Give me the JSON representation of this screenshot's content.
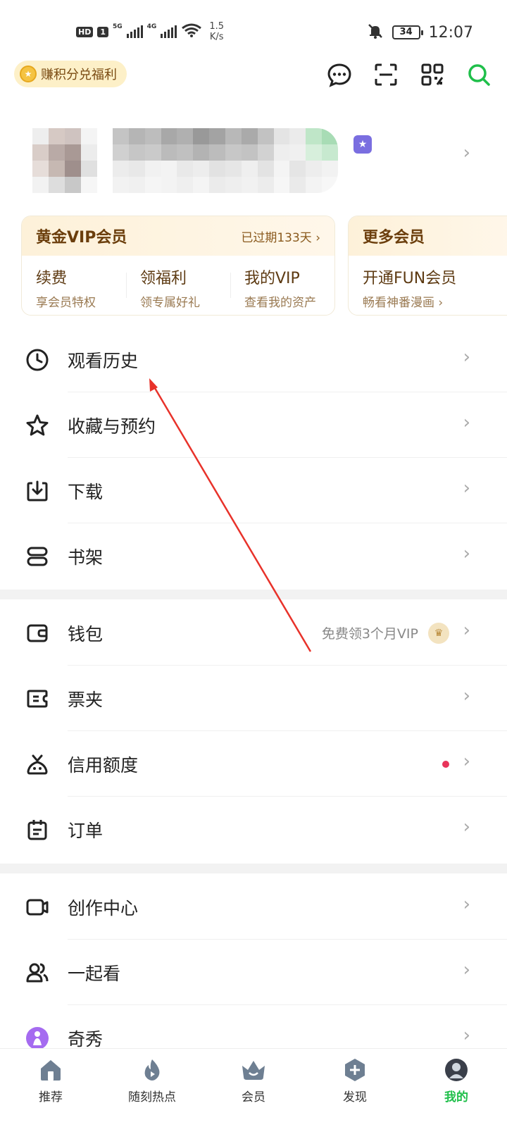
{
  "status_bar": {
    "hd": "HD",
    "sim": "1",
    "net1": "5G",
    "net2": "4G",
    "speed_value": "1.5",
    "speed_unit": "K/s",
    "battery": "34",
    "time": "12:07"
  },
  "header": {
    "points_label": "赚积分兑福利"
  },
  "vip_cards": {
    "gold": {
      "title": "黄金VIP会员",
      "expire": "已过期133天 ›",
      "items": [
        {
          "title": "续费",
          "sub": "享会员特权"
        },
        {
          "title": "领福利",
          "sub": "领专属好礼"
        },
        {
          "title": "我的VIP",
          "sub": "查看我的资产"
        }
      ]
    },
    "more": {
      "title": "更多会员",
      "items": [
        {
          "title": "开通FUN会员",
          "sub": "畅看神番漫画 ›"
        }
      ]
    }
  },
  "menu": {
    "history": "观看历史",
    "favorites": "收藏与预约",
    "download": "下载",
    "bookshelf": "书架",
    "wallet": "钱包",
    "wallet_promo": "免费领3个月VIP",
    "tickets": "票夹",
    "credit": "信用额度",
    "orders": "订单",
    "creator": "创作中心",
    "watch_together": "一起看",
    "qixiu": "奇秀"
  },
  "tabbar": {
    "tabs": [
      {
        "label": "推荐"
      },
      {
        "label": "随刻热点"
      },
      {
        "label": "会员"
      },
      {
        "label": "发现"
      },
      {
        "label": "我的"
      }
    ]
  },
  "colors": {
    "accent": "#1fbf4a",
    "vip_gold": "#6b3e0c",
    "annotation_arrow": "#e8322a"
  }
}
